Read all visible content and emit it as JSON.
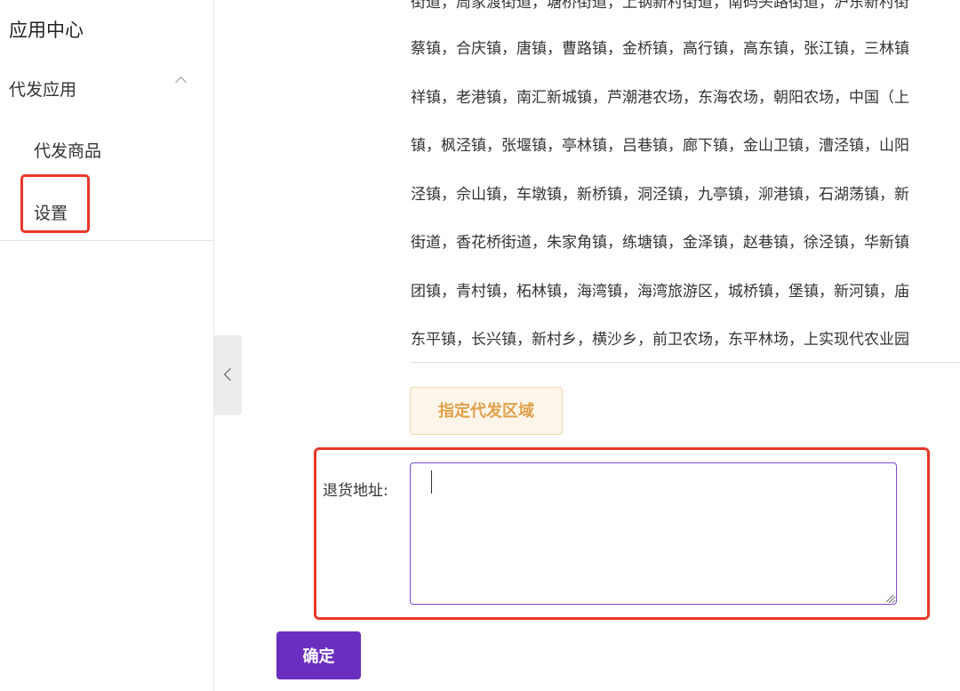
{
  "sidebar": {
    "title": "应用中心",
    "group": {
      "label": "代发应用"
    },
    "items": [
      {
        "label": "代发商品"
      },
      {
        "label": "设置"
      }
    ]
  },
  "area_lines": [
    "街道，周家渡街道，塘桥街道，上钢新村街道，南码头路街道，沪东新村街",
    "蔡镇，合庆镇，唐镇，曹路镇，金桥镇，高行镇，高东镇，张江镇，三林镇",
    "祥镇，老港镇，南汇新城镇，芦潮港农场，东海农场，朝阳农场，中国（上",
    "镇，枫泾镇，张堰镇，亭林镇，吕巷镇，廊下镇，金山卫镇，漕泾镇，山阳",
    "泾镇，佘山镇，车墩镇，新桥镇，洞泾镇，九亭镇，泖港镇，石湖荡镇，新",
    "街道，香花桥街道，朱家角镇，练塘镇，金泽镇，赵巷镇，徐泾镇，华新镇",
    "团镇，青村镇，柘林镇，海湾镇，海湾旅游区，城桥镇，堡镇，新河镇，庙",
    "东平镇，长兴镇，新村乡，横沙乡，前卫农场，东平林场，上实现代农业园"
  ],
  "assign_button": {
    "label": "指定代发区域"
  },
  "return_address": {
    "label": "退货地址:",
    "value": ""
  },
  "confirm_button": {
    "label": "确定"
  },
  "colors": {
    "highlight": "#e8372a",
    "primary": "#6b2fbf",
    "assign_bg": "#fdf5ea",
    "assign_text": "#e0a04a",
    "textarea_border": "#7b4bd8"
  }
}
